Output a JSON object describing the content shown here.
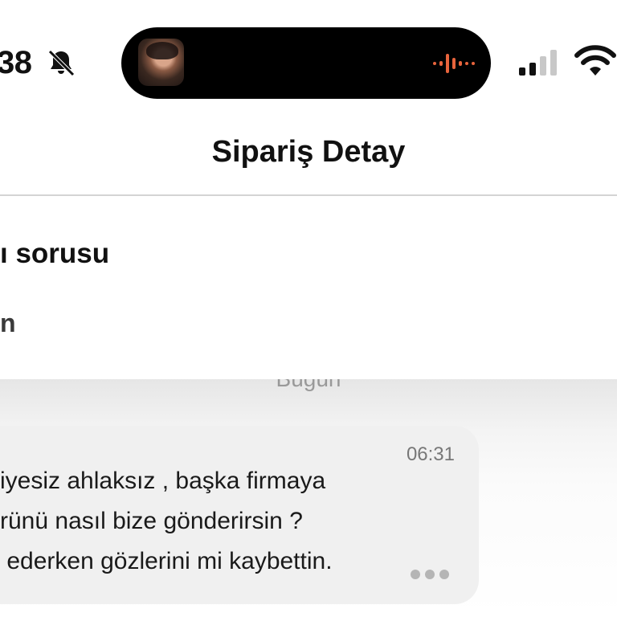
{
  "status_bar": {
    "time": "38",
    "icons": [
      "bell-slash-icon",
      "cellular-signal-icon",
      "wifi-icon"
    ],
    "dynamic_island": {
      "artwork": "album-art-thumbnail",
      "activity": "audio-waveform-icon",
      "accent": "#e8643c"
    }
  },
  "nav": {
    "title": "Sipariş Detay"
  },
  "topic": {
    "title": "ı sorusu",
    "subtitle": "n"
  },
  "chat": {
    "date_label": "Bugün",
    "messages": [
      {
        "time": "06:31",
        "lines": [
          "iyesiz ahlaksız , başka firmaya",
          "rünü nasıl bize gönderirsin ?",
          " ederken gözlerini mi kaybettin."
        ],
        "menu_icon": "more-dots-icon"
      }
    ]
  }
}
